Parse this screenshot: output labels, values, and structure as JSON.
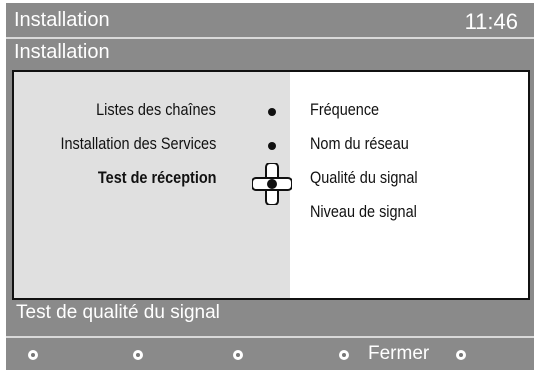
{
  "header": {
    "title": "Installation",
    "clock": "11:46"
  },
  "subtitle": "Installation",
  "menu": {
    "left_items": [
      {
        "label": "Listes des chaînes"
      },
      {
        "label": "Installation des Services"
      },
      {
        "label": "Test de réception",
        "selected": true
      }
    ],
    "right_items": [
      {
        "label": "Fréquence"
      },
      {
        "label": "Nom du réseau"
      },
      {
        "label": "Qualité du signal"
      },
      {
        "label": "Niveau de signal"
      }
    ]
  },
  "status": {
    "text": "Test de qualité du signal"
  },
  "footer": {
    "close_label": "Fermer"
  },
  "colors": {
    "background": "#8a8a8a",
    "panel": "#ffffff",
    "left_pane": "#e0e0e0"
  }
}
